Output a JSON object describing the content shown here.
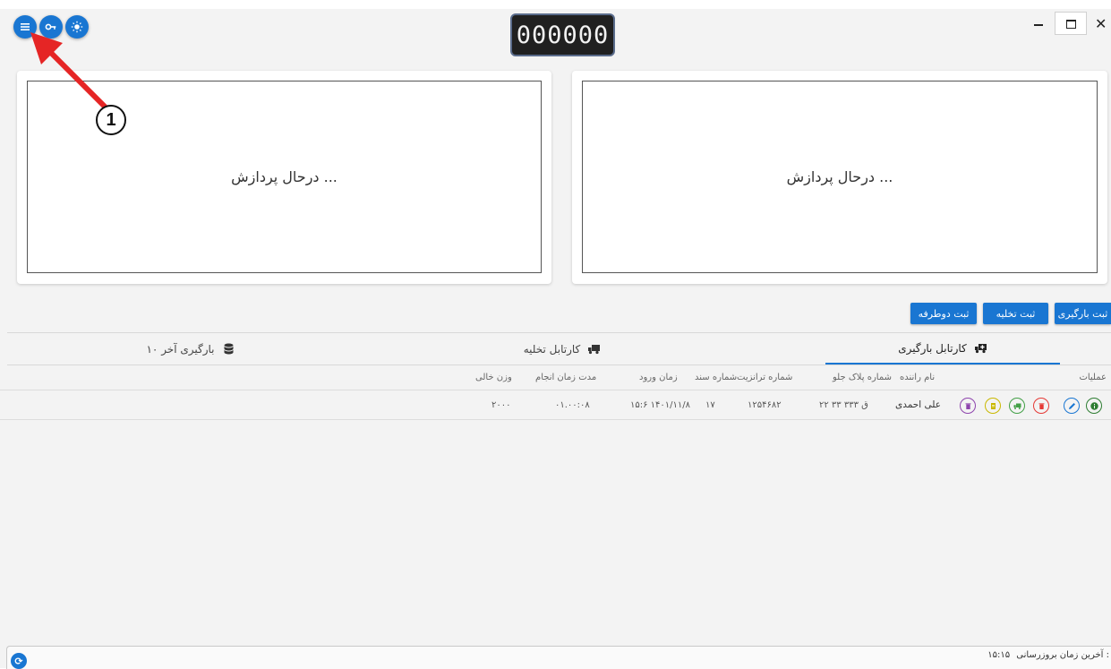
{
  "counter": {
    "value": "000000"
  },
  "panels": {
    "left": {
      "status": "درحال پردازش ..."
    },
    "right": {
      "status": "درحال پردازش ..."
    }
  },
  "actions": {
    "register_loading": "ثبت بارگیری",
    "register_unloading": "ثبت تخلیه",
    "register_two_way": "ثبت دوطرفه"
  },
  "tabs": [
    {
      "label": "کارتابل بارگیری",
      "icon": "truck-plus-icon",
      "active": true
    },
    {
      "label": "کارتابل تخلیه",
      "icon": "truck-icon",
      "active": false
    },
    {
      "label": "۱۰ بارگیری آخر",
      "icon": "database-icon",
      "active": false
    }
  ],
  "table": {
    "columns": {
      "operations": "عملیات",
      "driver_name": "نام راننده",
      "front_plate": "شماره پلاک جلو",
      "transit_number": "شماره ترانزیت",
      "document_number": "شماره سند",
      "entry_time": "زمان ورود",
      "duration": "مدت زمان انجام",
      "empty_weight": "وزن خالی"
    },
    "rows": [
      {
        "driver_name": "علی احمدی",
        "front_plate": "۲۲ ق ۳۳۳ ۳۳",
        "transit_number": "۱۲۵۴۶۸۲",
        "document_number": "۱۷",
        "entry_time": "۱۵:۶ ۱۴۰۱/۱۱/۸",
        "duration": "۰۱.۰۰:۰۸",
        "empty_weight": "۲۰۰۰"
      }
    ]
  },
  "row_operations": [
    {
      "icon": "info-icon",
      "color": "#2e7d32"
    },
    {
      "icon": "edit-icon",
      "color": "#1976d2"
    },
    {
      "icon": "delete-icon",
      "color": "#e53935"
    },
    {
      "icon": "truck-icon",
      "color": "#43a047"
    },
    {
      "icon": "document-icon",
      "color": "#c9b800"
    },
    {
      "icon": "trash-bin-icon",
      "color": "#8e44ad"
    }
  ],
  "footer": {
    "last_update_label": "آخرین زمان بروزرسانی :",
    "last_update_time": "۱۵:۱۵"
  },
  "annotation": {
    "number": "1"
  },
  "colors": {
    "primary": "#1976d2",
    "annotation_arrow": "#e52525"
  }
}
